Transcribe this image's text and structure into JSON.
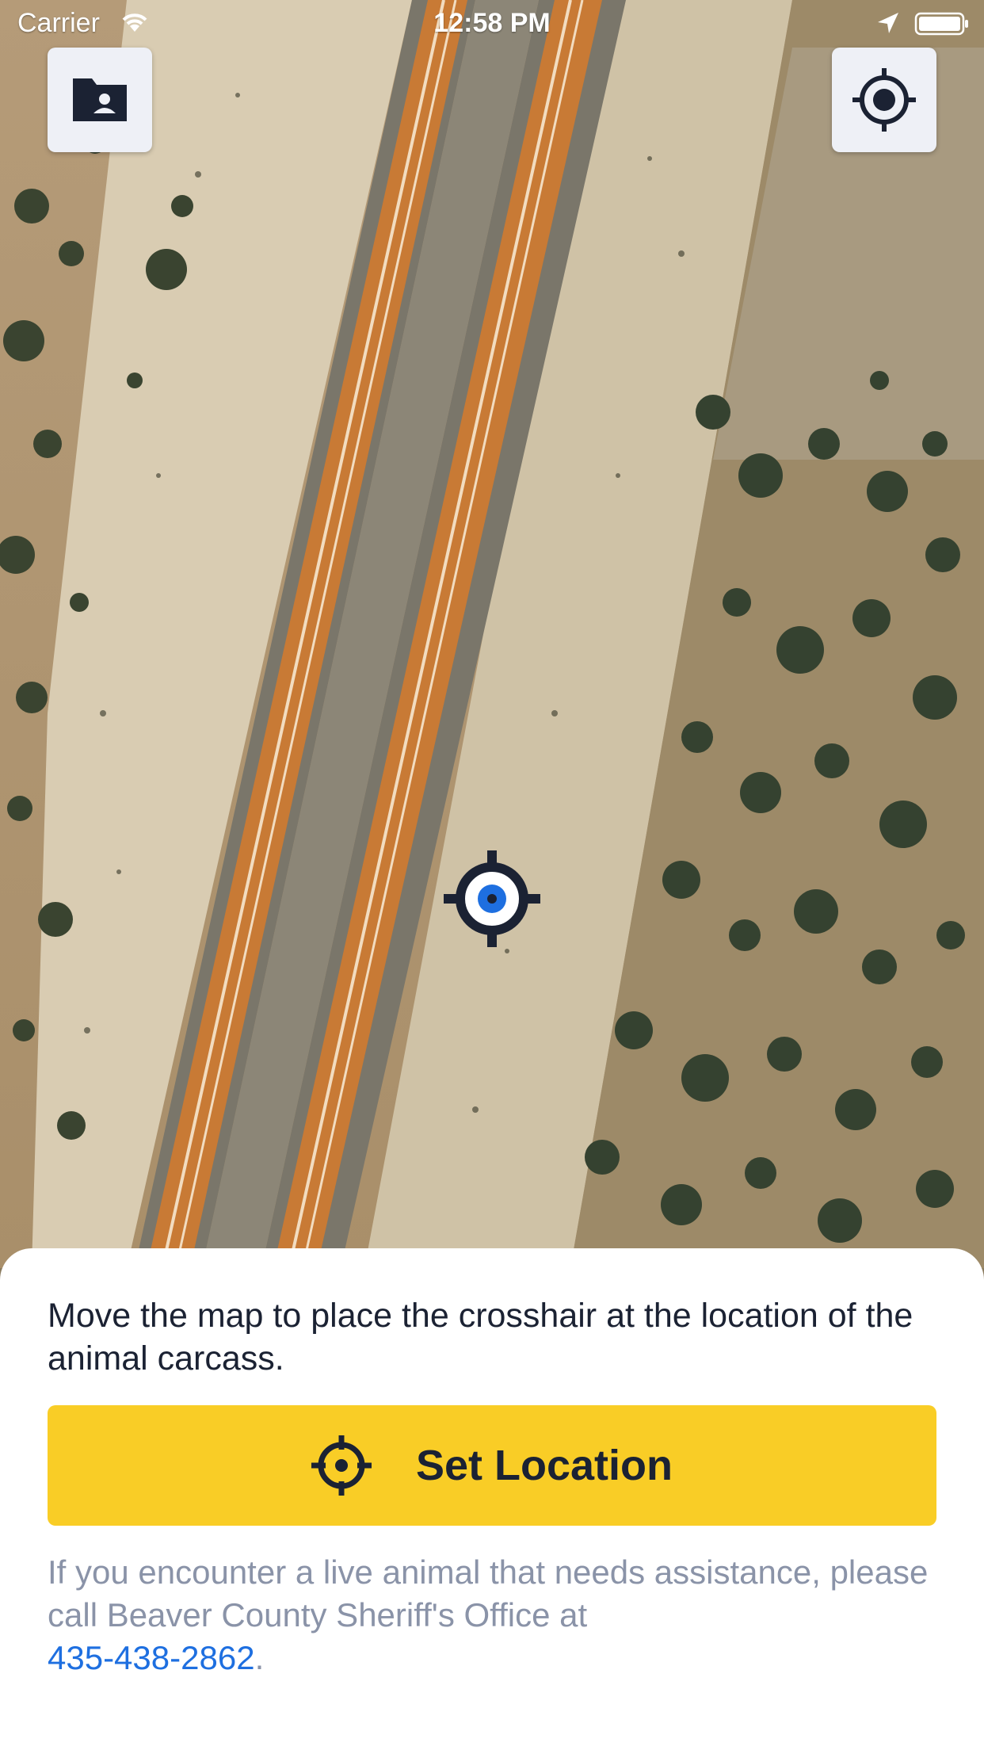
{
  "status_bar": {
    "carrier": "Carrier",
    "time": "12:58 PM"
  },
  "map": {
    "contacts_button_icon": "contact-folder-icon",
    "locate_button_icon": "gps-locate-icon",
    "crosshair_icon": "crosshair-target-icon"
  },
  "sheet": {
    "instructions": "Move the map to place the crosshair at the location of the animal carcass.",
    "set_location_label": "Set Location",
    "help_text": "If you encounter a live animal that needs assistance, please call Beaver County Sheriff's Office at",
    "phone": "435-438-2862",
    "phone_suffix": "."
  },
  "colors": {
    "accent_yellow": "#f9cd26",
    "dark_navy": "#1b2233",
    "link_blue": "#1e6fe0",
    "muted_gray": "#8a93a8",
    "road_orange": "#c87a35"
  }
}
